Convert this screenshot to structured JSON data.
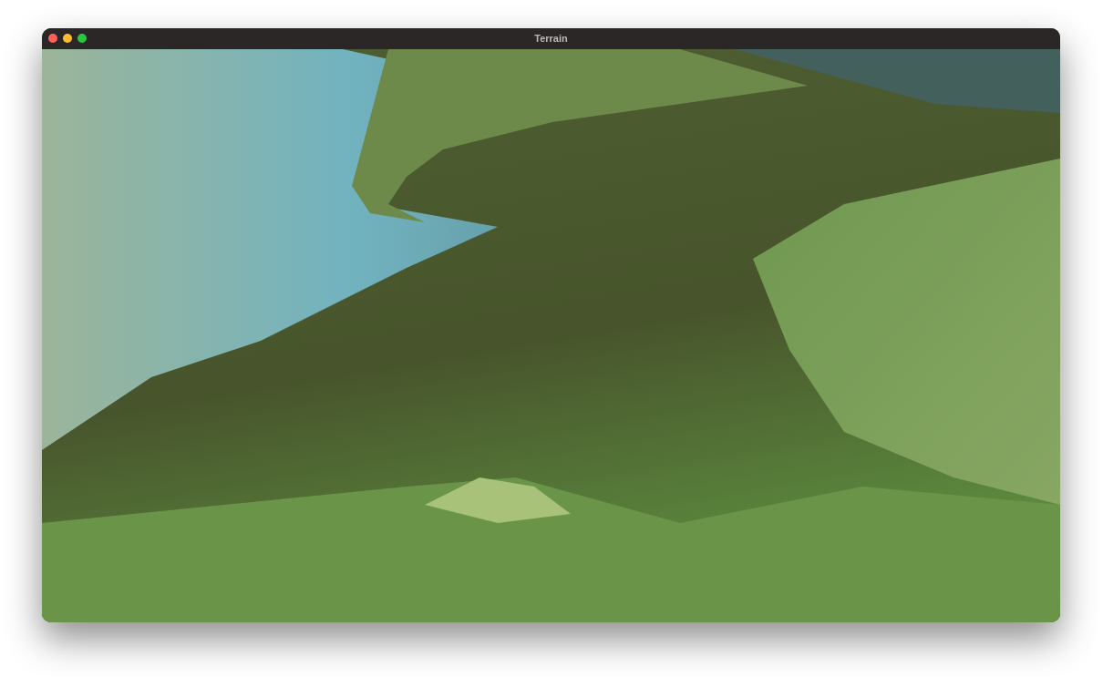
{
  "window": {
    "title": "Terrain"
  }
}
